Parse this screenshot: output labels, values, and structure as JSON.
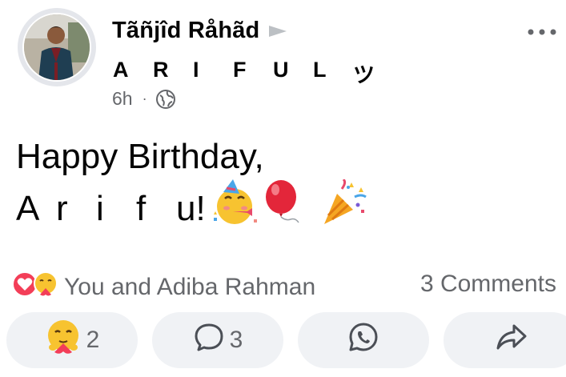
{
  "post": {
    "author_name": "Tãñjîd Råhãd",
    "group_letters": [
      "A",
      "R",
      "I",
      "F",
      "U",
      "L",
      "ツ"
    ],
    "time_ago": "6h",
    "meta_separator": "·",
    "text_line1": "Happy Birthday,",
    "text_line2_letters": [
      "A",
      "r",
      "i",
      "f"
    ],
    "text_line2_end": "u!"
  },
  "reactions": {
    "summary": "You and Adiba Rahman",
    "comments_label": "3 Comments"
  },
  "actions": {
    "react_count": "2",
    "comment_count": "3"
  },
  "icons": {
    "avatar": "profile-photo",
    "play": "caret-right-icon",
    "more": "more-dots-icon",
    "audience": "globe-icon",
    "love": "love-reaction-icon",
    "care": "care-reaction-icon",
    "comment": "comment-icon",
    "whatsapp": "whatsapp-icon",
    "share": "share-icon"
  }
}
